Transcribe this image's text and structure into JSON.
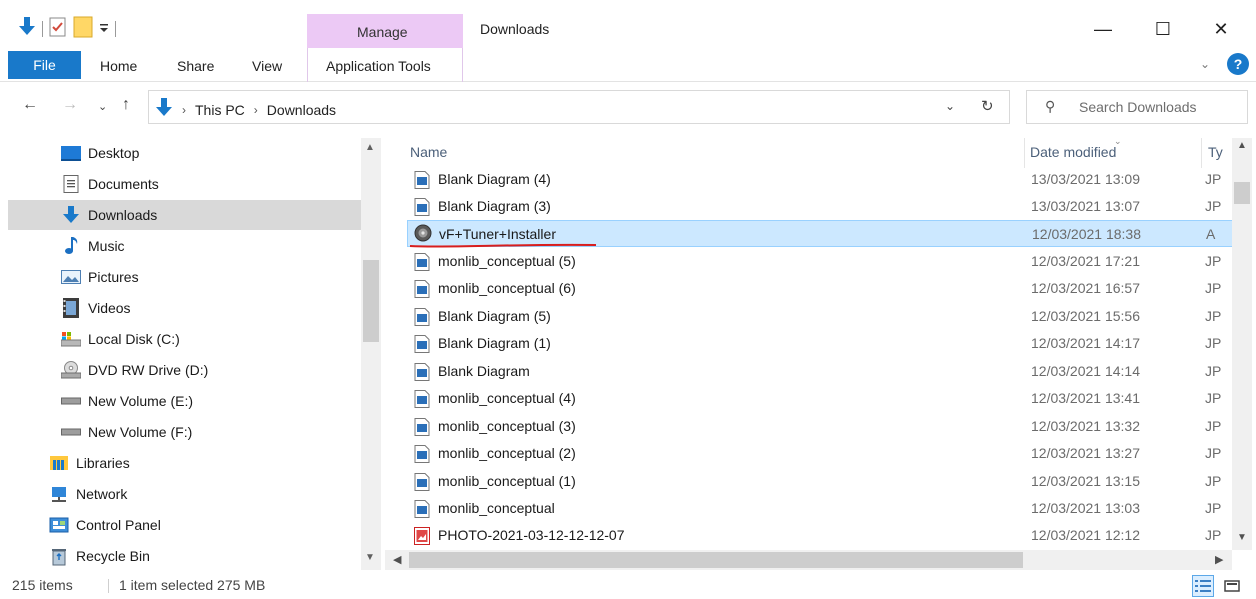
{
  "window": {
    "title": "Downloads",
    "contextual_tab_group": "Manage",
    "minimize_glyph": "—",
    "maximize_glyph": "☐",
    "close_glyph": "✕"
  },
  "ribbon": {
    "tabs": {
      "file": "File",
      "home": "Home",
      "share": "Share",
      "view": "View",
      "app_tools": "Application Tools"
    },
    "help_label": "?",
    "file_tab_color": "#1979ca",
    "manage_color": "#ecc9f5"
  },
  "address": {
    "crumbs": [
      "This PC",
      "Downloads"
    ]
  },
  "search": {
    "placeholder": "Search Downloads"
  },
  "nav": {
    "items": [
      {
        "label": "Desktop",
        "icon": "desktop-icon"
      },
      {
        "label": "Documents",
        "icon": "documents-icon"
      },
      {
        "label": "Downloads",
        "icon": "downloads-icon",
        "selected": true
      },
      {
        "label": "Music",
        "icon": "music-icon"
      },
      {
        "label": "Pictures",
        "icon": "pictures-icon"
      },
      {
        "label": "Videos",
        "icon": "videos-icon"
      },
      {
        "label": "Local Disk (C:)",
        "icon": "local-disk-icon"
      },
      {
        "label": "DVD RW Drive (D:)",
        "icon": "dvd-drive-icon"
      },
      {
        "label": "New Volume (E:)",
        "icon": "drive-icon"
      },
      {
        "label": "New Volume (F:)",
        "icon": "drive-icon"
      },
      {
        "label": "Libraries",
        "icon": "libraries-icon"
      },
      {
        "label": "Network",
        "icon": "network-icon"
      },
      {
        "label": "Control Panel",
        "icon": "control-panel-icon"
      },
      {
        "label": "Recycle Bin",
        "icon": "recycle-bin-icon"
      }
    ]
  },
  "filelist": {
    "columns": {
      "name": "Name",
      "date": "Date modified",
      "type": "Ty"
    },
    "rows": [
      {
        "name": "Blank Diagram (4)",
        "date": "13/03/2021 13:09",
        "type": "JP",
        "icon": "image-file-icon"
      },
      {
        "name": "Blank Diagram (3)",
        "date": "13/03/2021 13:07",
        "type": "JP",
        "icon": "image-file-icon"
      },
      {
        "name": "vF+Tuner+Installer",
        "date": "12/03/2021 18:38",
        "type": "A",
        "icon": "installer-icon",
        "selected": true
      },
      {
        "name": "monlib_conceptual (5)",
        "date": "12/03/2021 17:21",
        "type": "JP",
        "icon": "image-file-icon"
      },
      {
        "name": "monlib_conceptual (6)",
        "date": "12/03/2021 16:57",
        "type": "JP",
        "icon": "image-file-icon"
      },
      {
        "name": "Blank Diagram (5)",
        "date": "12/03/2021 15:56",
        "type": "JP",
        "icon": "image-file-icon"
      },
      {
        "name": "Blank Diagram (1)",
        "date": "12/03/2021 14:17",
        "type": "JP",
        "icon": "image-file-icon"
      },
      {
        "name": "Blank Diagram",
        "date": "12/03/2021 14:14",
        "type": "JP",
        "icon": "image-file-icon"
      },
      {
        "name": "monlib_conceptual (4)",
        "date": "12/03/2021 13:41",
        "type": "JP",
        "icon": "image-file-icon"
      },
      {
        "name": "monlib_conceptual (3)",
        "date": "12/03/2021 13:32",
        "type": "JP",
        "icon": "image-file-icon"
      },
      {
        "name": "monlib_conceptual (2)",
        "date": "12/03/2021 13:27",
        "type": "JP",
        "icon": "image-file-icon"
      },
      {
        "name": "monlib_conceptual (1)",
        "date": "12/03/2021 13:15",
        "type": "JP",
        "icon": "image-file-icon"
      },
      {
        "name": "monlib_conceptual",
        "date": "12/03/2021 13:03",
        "type": "JP",
        "icon": "image-file-icon"
      },
      {
        "name": "PHOTO-2021-03-12-12-12-07",
        "date": "12/03/2021 12:12",
        "type": "JP",
        "icon": "photo-file-icon"
      }
    ],
    "selection_color": "#cce8ff",
    "annotation_color": "#d81e1e"
  },
  "status": {
    "item_count": "215 items",
    "selection": "1 item selected  275 MB"
  }
}
